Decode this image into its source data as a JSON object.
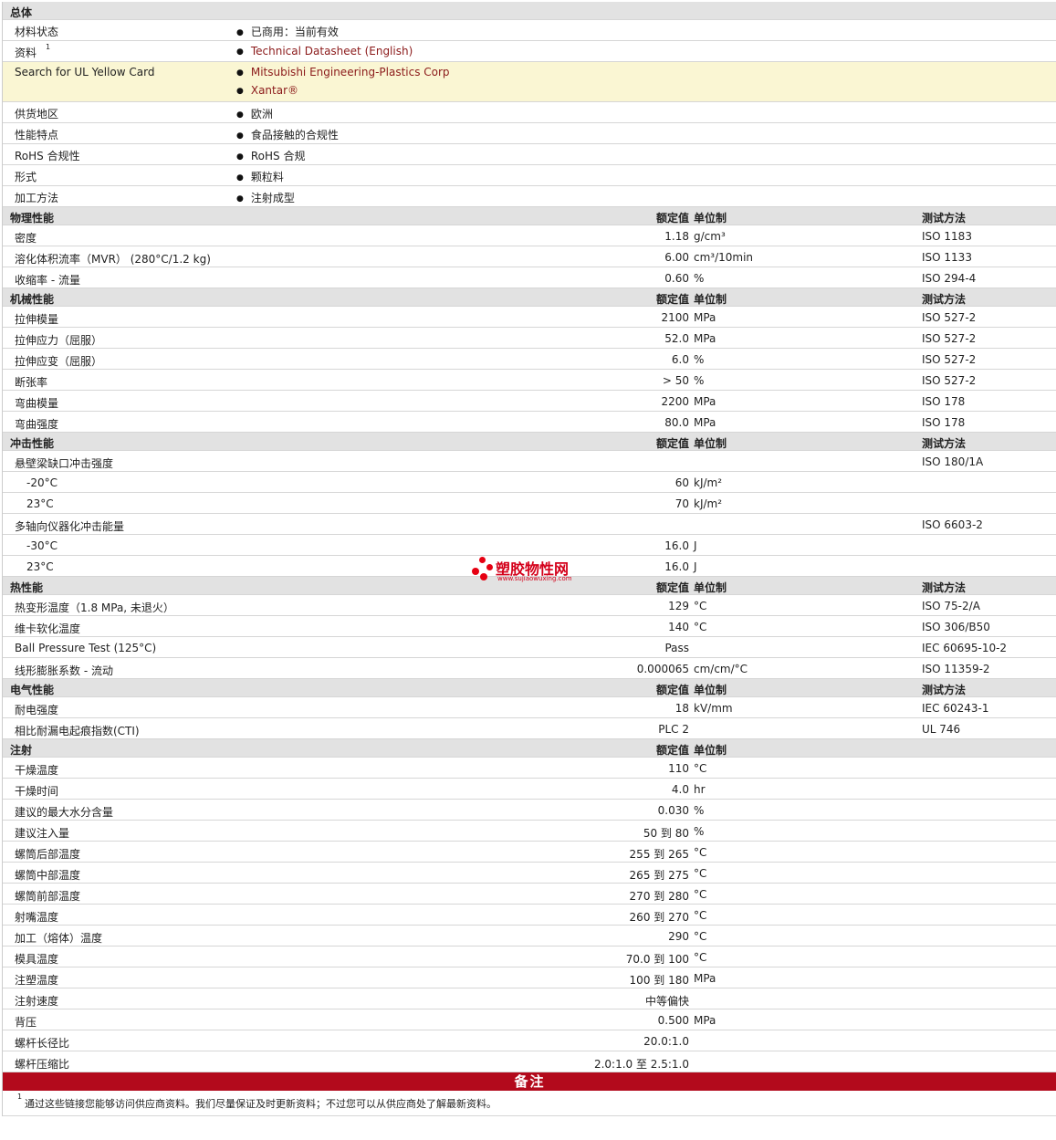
{
  "general": {
    "title": "总体",
    "rows": [
      {
        "label": "材料状态",
        "items": [
          "已商用：当前有效"
        ]
      },
      {
        "label": "资料",
        "sup": "1",
        "items": [
          "Technical Datasheet (English)"
        ],
        "link": true
      },
      {
        "label": "Search for UL Yellow Card",
        "items": [
          "Mitsubishi Engineering-Plastics Corp",
          "Xantar®"
        ],
        "link": true,
        "highlight": true
      },
      {
        "label": "供货地区",
        "items": [
          "欧洲"
        ]
      },
      {
        "label": "性能特点",
        "items": [
          "食品接触的合规性"
        ]
      },
      {
        "label": "RoHS 合规性",
        "items": [
          "RoHS 合规"
        ]
      },
      {
        "label": "形式",
        "items": [
          "颗粒料"
        ]
      },
      {
        "label": "加工方法",
        "items": [
          "注射成型"
        ]
      }
    ]
  },
  "headers": {
    "value": "额定值",
    "unit": "单位制",
    "method": "测试方法"
  },
  "sections": [
    {
      "title": "物理性能",
      "show_method": true,
      "rows": [
        {
          "label": "密度",
          "value": "1.18",
          "unit": "g/cm³",
          "method": "ISO 1183"
        },
        {
          "label": "溶化体积流率（MVR）  (280°C/1.2 kg)",
          "value": "6.00",
          "unit": "cm³/10min",
          "method": "ISO 1133"
        },
        {
          "label": "收缩率  - 流量",
          "value": "0.60",
          "unit": "%",
          "method": "ISO 294-4"
        }
      ]
    },
    {
      "title": "机械性能",
      "show_method": true,
      "rows": [
        {
          "label": "拉伸模量",
          "value": "2100",
          "unit": "MPa",
          "method": "ISO 527-2"
        },
        {
          "label": "拉伸应力（屈服）",
          "value": "52.0",
          "unit": "MPa",
          "method": "ISO 527-2"
        },
        {
          "label": "拉伸应变（屈服）",
          "value": "6.0",
          "unit": "%",
          "method": "ISO 527-2"
        },
        {
          "label": "断张率",
          "value": "> 50",
          "unit": "%",
          "method": "ISO 527-2"
        },
        {
          "label": "弯曲模量",
          "value": "2200",
          "unit": "MPa",
          "method": "ISO 178"
        },
        {
          "label": "弯曲强度",
          "value": "80.0",
          "unit": "MPa",
          "method": "ISO 178"
        }
      ]
    },
    {
      "title": "冲击性能",
      "show_method": true,
      "rows": [
        {
          "label": "悬壁梁缺口冲击强度",
          "value": "",
          "unit": "",
          "method": "ISO 180/1A"
        },
        {
          "label": "-20°C",
          "sub": true,
          "value": "60",
          "unit": "kJ/m²",
          "method": ""
        },
        {
          "label": "23°C",
          "sub": true,
          "value": "70",
          "unit": "kJ/m²",
          "method": ""
        },
        {
          "label": "多轴向仪器化冲击能量",
          "value": "",
          "unit": "",
          "method": "ISO 6603-2"
        },
        {
          "label": "-30°C",
          "sub": true,
          "value": "16.0",
          "unit": "J",
          "method": ""
        },
        {
          "label": "23°C",
          "sub": true,
          "value": "16.0",
          "unit": "J",
          "method": ""
        }
      ]
    },
    {
      "title": "热性能",
      "show_method": true,
      "rows": [
        {
          "label": "热变形温度（1.8 MPa, 未退火）",
          "value": "129",
          "unit": "°C",
          "method": "ISO 75-2/A"
        },
        {
          "label": "维卡软化温度",
          "value": "140",
          "unit": "°C",
          "method": "ISO 306/B50"
        },
        {
          "label": "Ball Pressure Test (125°C)",
          "value": "Pass",
          "unit": "",
          "method": "IEC 60695-10-2"
        },
        {
          "label": "线形膨胀系数  - 流动",
          "value": "0.000065",
          "unit": "cm/cm/°C",
          "method": "ISO 11359-2"
        }
      ]
    },
    {
      "title": "电气性能",
      "show_method": true,
      "rows": [
        {
          "label": "耐电强度",
          "value": "18",
          "unit": "kV/mm",
          "method": "IEC 60243-1"
        },
        {
          "label": "相比耐漏电起痕指数(CTI)",
          "value": "PLC 2",
          "unit": "",
          "method": "UL 746"
        }
      ]
    },
    {
      "title": "注射",
      "show_method": false,
      "rows": [
        {
          "label": "干燥温度",
          "value": "110",
          "unit": "°C",
          "method": ""
        },
        {
          "label": "干燥时间",
          "value": "4.0",
          "unit": "hr",
          "method": ""
        },
        {
          "label": "建议的最大水分含量",
          "value": "0.030",
          "unit": "%",
          "method": ""
        },
        {
          "label": "建议注入量",
          "value": "50 到  80",
          "unit": "%",
          "method": ""
        },
        {
          "label": "螺筒后部温度",
          "value": "255 到  265",
          "unit": "°C",
          "method": ""
        },
        {
          "label": "螺筒中部温度",
          "value": "265 到  275",
          "unit": "°C",
          "method": ""
        },
        {
          "label": "螺筒前部温度",
          "value": "270 到  280",
          "unit": "°C",
          "method": ""
        },
        {
          "label": "射嘴温度",
          "value": "260 到  270",
          "unit": "°C",
          "method": ""
        },
        {
          "label": "加工（熔体）温度",
          "value": "290",
          "unit": "°C",
          "method": ""
        },
        {
          "label": "模具温度",
          "value": "70.0 到  100",
          "unit": "°C",
          "method": ""
        },
        {
          "label": "注塑温度",
          "value": "100 到  180",
          "unit": "MPa",
          "method": ""
        },
        {
          "label": "注射速度",
          "value": "中等偏快",
          "unit": "",
          "method": ""
        },
        {
          "label": "背压",
          "value": "0.500",
          "unit": "MPa",
          "method": ""
        },
        {
          "label": "螺杆长径比",
          "value": "20.0:1.0",
          "unit": "",
          "method": ""
        },
        {
          "label": "螺杆压缩比",
          "value": "2.0:1.0 至  2.5:1.0",
          "unit": "",
          "method": ""
        }
      ]
    }
  ],
  "notes": {
    "title": "备注",
    "sup": "1",
    "text": "通过这些链接您能够访问供应商资料。我们尽量保证及时更新资料；不过您可以从供应商处了解最新资料。"
  },
  "watermark": {
    "name": "塑胶物性网",
    "url": "www.sujiaowuxing.com",
    "color": "#e60012"
  }
}
